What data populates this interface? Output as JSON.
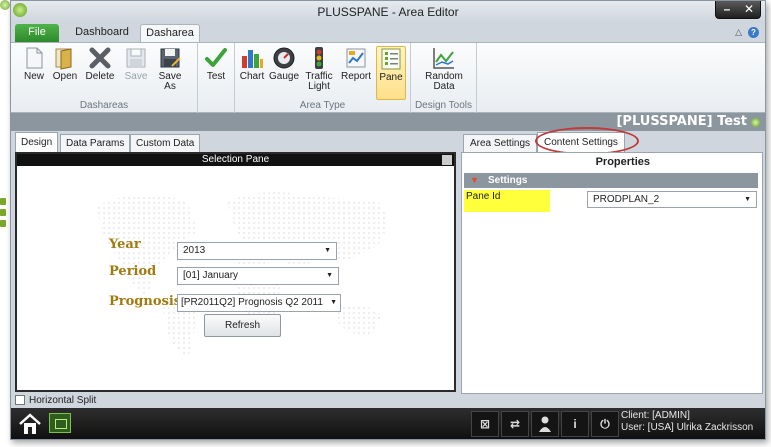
{
  "window": {
    "title": "PLUSSPANE - Area Editor",
    "minimize_glyph": "–",
    "close_glyph": "✕"
  },
  "ribbon_tabs": {
    "file": "File",
    "tabs": [
      "Dashboard",
      "Dasharea"
    ],
    "active": "Dasharea"
  },
  "ribbon": {
    "groups": [
      {
        "label": "Dashareas",
        "buttons": [
          {
            "label": "New",
            "icon": "new-doc-icon",
            "enabled": true
          },
          {
            "label": "Open",
            "icon": "open-folder-icon",
            "enabled": true
          },
          {
            "label": "Delete",
            "icon": "delete-x-icon",
            "enabled": true
          },
          {
            "label": "Save",
            "icon": "save-disk-icon",
            "enabled": false
          },
          {
            "label": "Save As",
            "icon": "save-as-icon",
            "enabled": true
          }
        ]
      },
      {
        "label": "",
        "buttons": [
          {
            "label": "Test",
            "icon": "checkmark-icon",
            "enabled": true
          }
        ]
      },
      {
        "label": "Area Type",
        "buttons": [
          {
            "label": "Chart",
            "icon": "bar-chart-icon",
            "enabled": true
          },
          {
            "label": "Gauge",
            "icon": "gauge-icon",
            "enabled": true
          },
          {
            "label": "Traffic Light",
            "icon": "traffic-light-icon",
            "enabled": true
          },
          {
            "label": "Report",
            "icon": "report-icon",
            "enabled": true
          },
          {
            "label": "Pane",
            "icon": "pane-icon",
            "enabled": true,
            "selected": true
          }
        ]
      },
      {
        "label": "Design Tools",
        "buttons": [
          {
            "label": "Random Data",
            "icon": "line-chart-icon",
            "enabled": true
          }
        ]
      }
    ]
  },
  "header": {
    "title": "[PLUSSPANE] Test",
    "status_color": "#6aa626"
  },
  "left": {
    "tabs": [
      "Design",
      "Data Params",
      "Custom Data"
    ],
    "active_tab": "Design",
    "pane_title": "Selection Pane",
    "fields": [
      {
        "label": "Year",
        "value": "2013"
      },
      {
        "label": "Period",
        "value": "[01] January"
      },
      {
        "label": "Prognosis",
        "value": "[PR2011Q2] Prognosis Q2 2011"
      }
    ],
    "refresh_label": "Refresh",
    "label_color": "#a07a10"
  },
  "right": {
    "tabs": [
      "Area Settings",
      "Content Settings"
    ],
    "active_tab": "Content Settings",
    "properties_title": "Properties",
    "section": "Settings",
    "property": {
      "label": "Pane Id",
      "value": "PRODPLAN_2"
    }
  },
  "bottom": {
    "horizontal_split": "Horizontal Split",
    "client_line": "Client: [ADMIN]",
    "user_line": "User: [USA] Ulrika Zackrisson"
  }
}
